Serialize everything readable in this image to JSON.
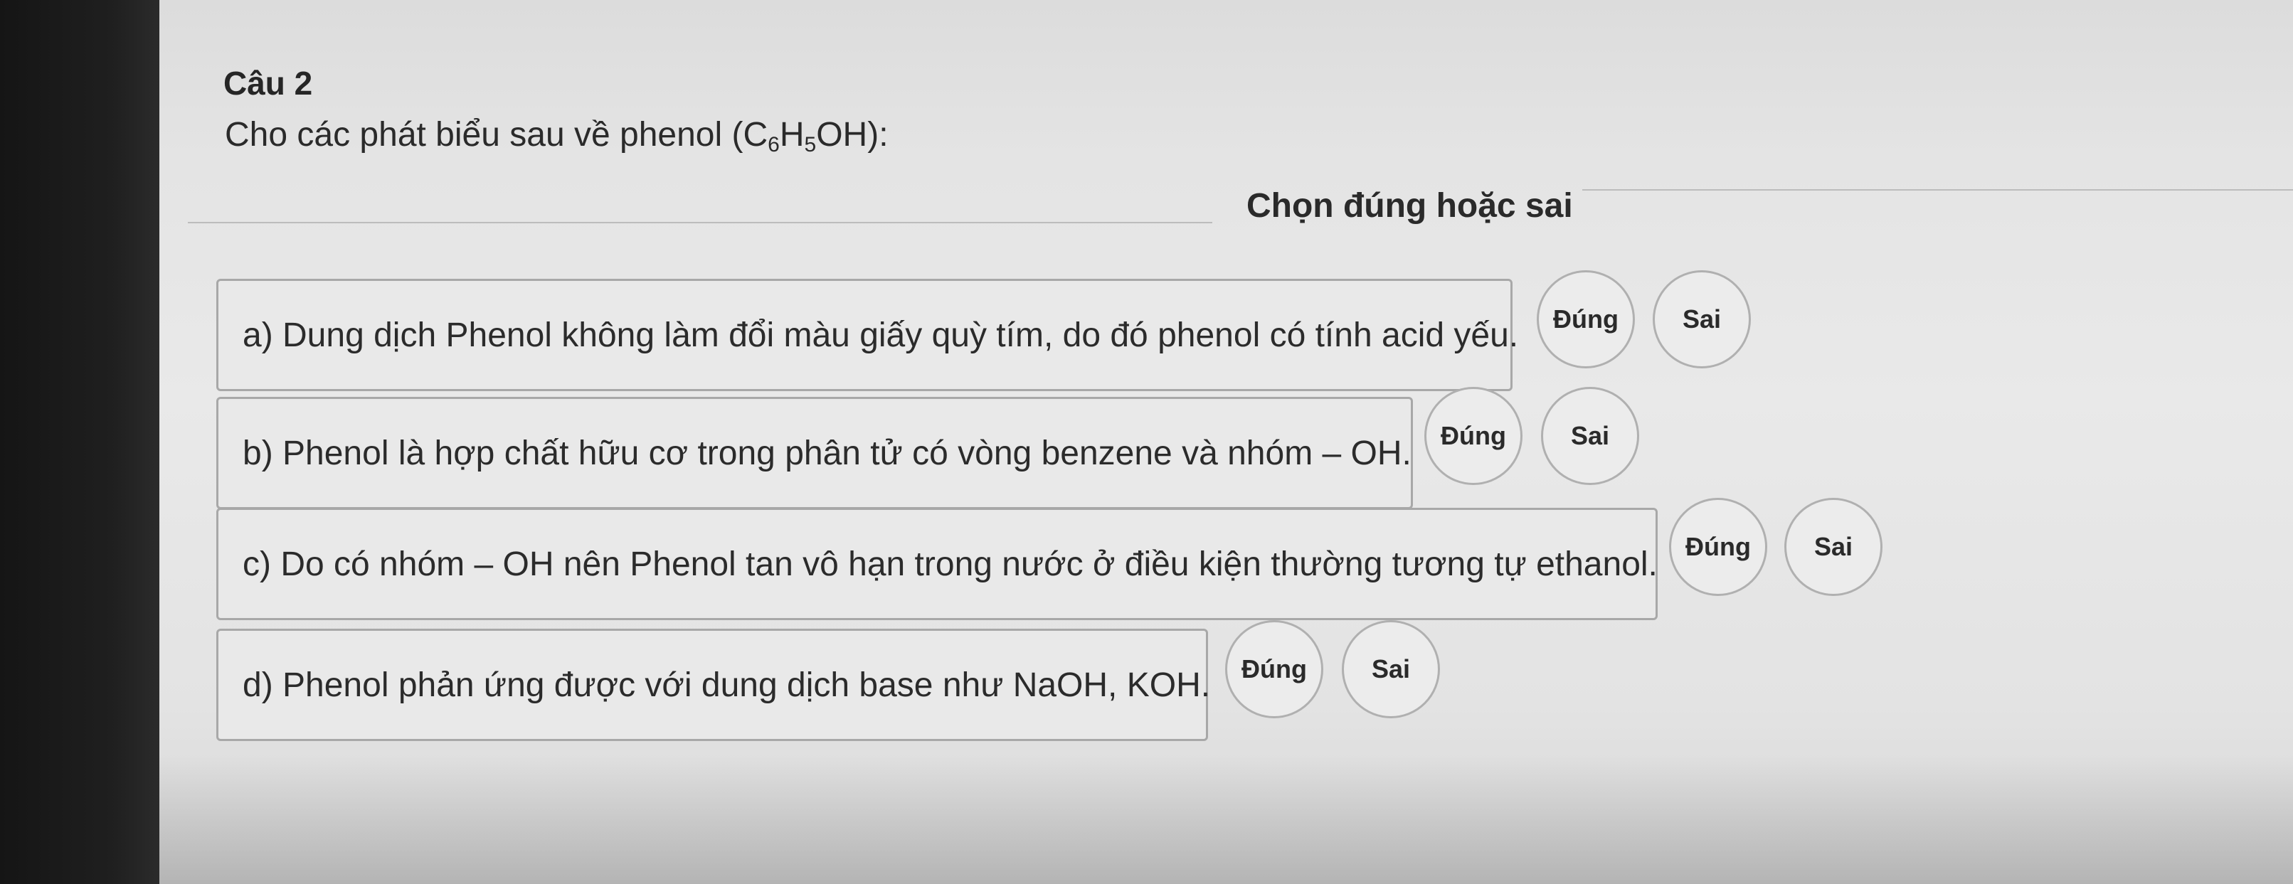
{
  "question": {
    "number_label": "Câu 2",
    "intro_prefix": "Cho các phát biểu sau về phenol (C",
    "intro_sub1": "6",
    "intro_mid": "H",
    "intro_sub2": "5",
    "intro_suffix": "OH):",
    "instruction": "Chọn đúng hoặc sai"
  },
  "statements": [
    {
      "text": "a) Dung dịch Phenol không làm đổi màu giấy quỳ tím, do đó phenol có tính acid yếu.",
      "true_label": "Đúng",
      "false_label": "Sai"
    },
    {
      "text": "b) Phenol là hợp chất hữu cơ trong phân tử có vòng benzene và nhóm – OH.",
      "true_label": "Đúng",
      "false_label": "Sai"
    },
    {
      "text": "c) Do có nhóm – OH nên Phenol tan vô hạn trong nước ở điều kiện thường tương tự ethanol.",
      "true_label": "Đúng",
      "false_label": "Sai"
    },
    {
      "text": "d) Phenol phản ứng được với dung dịch base như NaOH, KOH.",
      "true_label": "Đúng",
      "false_label": "Sai"
    }
  ]
}
